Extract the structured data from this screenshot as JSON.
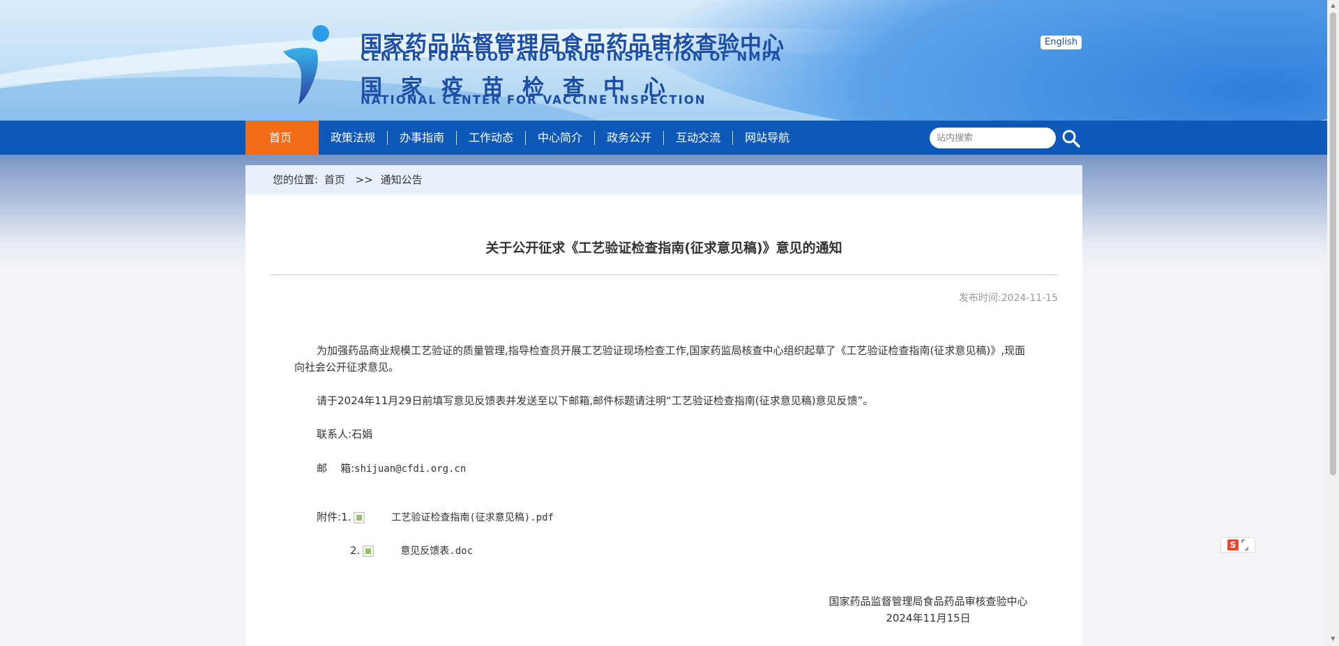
{
  "header": {
    "title_cn": "国家药品监督管理局食品药品审核查验中心",
    "title_en": "CENTER FOR FOOD AND DRUG INSPECTION OF NMPA",
    "subtitle_cn": "国家疫苗检查中心",
    "subtitle_en": "NATIONAL CENTER FOR VACCINE INSPECTION",
    "english_label": "English"
  },
  "nav": {
    "items": [
      "首页",
      "政策法规",
      "办事指南",
      "工作动态",
      "中心简介",
      "政务公开",
      "互动交流",
      "网站导航"
    ],
    "search_placeholder": "站内搜索"
  },
  "breadcrumb": {
    "prefix": "您的位置:",
    "home": "首页",
    "sep": ">>",
    "current": "通知公告"
  },
  "article": {
    "title": "关于公开征求《工艺验证检查指南(征求意见稿)》意见的通知",
    "publish_time": "发布时间:2024-11-15",
    "paragraph1": "为加强药品商业规模工艺验证的质量管理,指导检查员开展工艺验证现场检查工作,国家药监局核查中心组织起草了《工艺验证检查指南(征求意见稿)》,现面向社会公开征求意见。",
    "paragraph2": "请于2024年11月29日前填写意见反馈表并发送至以下邮箱,邮件标题请注明“工艺验证检查指南(征求意见稿)意见反馈”。",
    "contact_label": "联系人:",
    "contact_name": "石娟",
    "email_label": "邮    箱:",
    "email": "shijuan@cfdi.org.cn",
    "attachments_label": "附件:",
    "attachments": [
      {
        "index": "1.",
        "name": "工艺验证检查指南(征求意见稿).pdf"
      },
      {
        "index": "2.",
        "name": "意见反馈表.doc"
      }
    ],
    "signature_org": "国家药品监督管理局食品药品审核查验中心",
    "signature_date": "2024年11月15日"
  },
  "widget": {
    "icon": "S"
  }
}
